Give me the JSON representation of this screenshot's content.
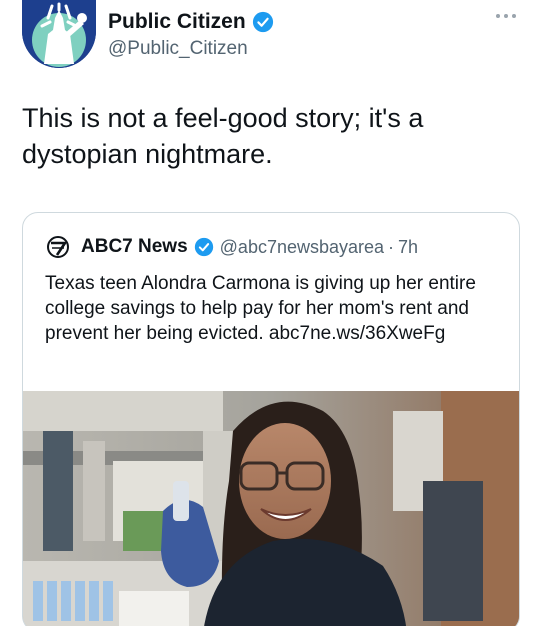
{
  "author": {
    "display_name": "Public Citizen",
    "handle": "@Public_Citizen",
    "avatar_icon": "statue-of-liberty-logo-icon",
    "verified_icon": "verified-badge-icon"
  },
  "tweet": {
    "text": "This is not a feel-good story; it's a dystopian nightmare."
  },
  "quoted_tweet": {
    "logo_icon": "abc7-logo-icon",
    "display_name": "ABC7 News",
    "handle": "@abc7newsbayarea",
    "separator": "·",
    "time": "7h",
    "text": "Texas teen Alondra Carmona is giving up her entire college savings to help pay for her mom's rent and prevent her being evicted. abc7ne.ws/36XweFg",
    "photo_icon": "lab-photo-student-smiling"
  },
  "colors": {
    "text_primary": "#0f1419",
    "text_secondary": "#536471",
    "verified_blue": "#1d9bf0",
    "border": "#cfd9de"
  }
}
